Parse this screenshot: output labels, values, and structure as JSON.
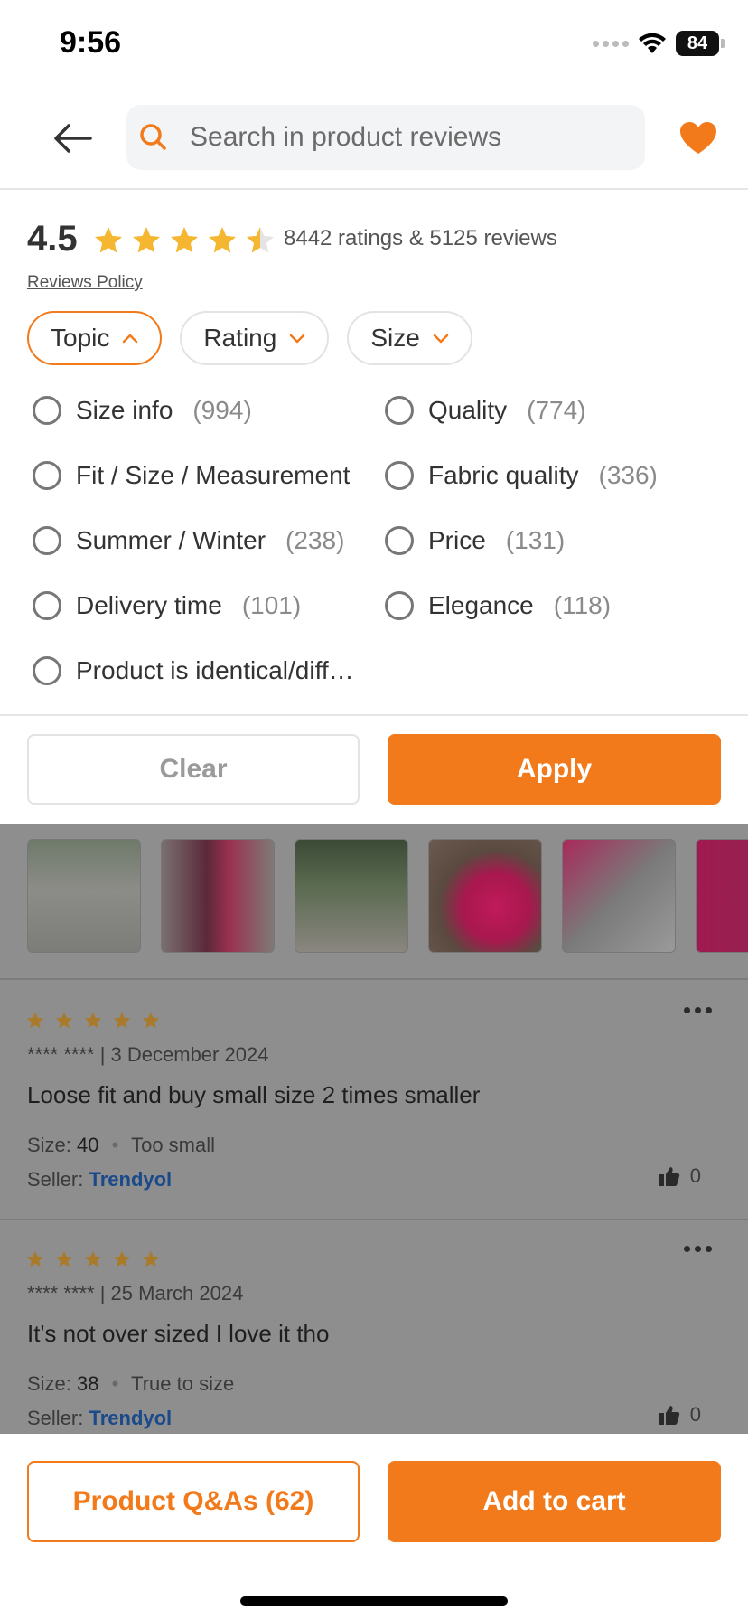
{
  "status_bar": {
    "time": "9:56",
    "battery": "84",
    "icons": [
      "signal-icon",
      "wifi-icon",
      "battery-icon"
    ]
  },
  "header": {
    "search_placeholder": "Search in product reviews",
    "icons": [
      "back-arrow-icon",
      "search-icon",
      "heart-icon"
    ]
  },
  "summary": {
    "rating": "4.5",
    "stars": 4.5,
    "rating_count": "8442 ratings & 5125 reviews",
    "policy_link": "Reviews Policy"
  },
  "filters": {
    "chips": [
      {
        "label": "Topic",
        "active": true
      },
      {
        "label": "Rating",
        "active": false
      },
      {
        "label": "Size",
        "active": false
      }
    ]
  },
  "topics": [
    {
      "label": "Size info",
      "count": "(994)"
    },
    {
      "label": "Quality",
      "count": "(774)"
    },
    {
      "label": "Fit / Size / Measurement",
      "count": ""
    },
    {
      "label": "Fabric quality",
      "count": "(336)"
    },
    {
      "label": "Summer / Winter",
      "count": "(238)"
    },
    {
      "label": "Price",
      "count": "(131)"
    },
    {
      "label": "Delivery time",
      "count": "(101)"
    },
    {
      "label": "Elegance",
      "count": "(118)"
    },
    {
      "label": "Product is identical/different",
      "count": ""
    }
  ],
  "actions": {
    "clear": "Clear",
    "apply": "Apply"
  },
  "reviews": [
    {
      "stars": 5,
      "author_date": "**** **** | 3 December 2024",
      "text": "Loose fit and buy small size 2 times smaller",
      "size_label": "Size:",
      "size_value": "40",
      "fit": "Too small",
      "seller_label": "Seller:",
      "seller": "Trendyol",
      "likes": "0"
    },
    {
      "stars": 5,
      "author_date": "**** **** | 25 March 2024",
      "text": "It's not over sized I love it tho",
      "size_label": "Size:",
      "size_value": "38",
      "fit": "True to size",
      "seller_label": "Seller:",
      "seller": "Trendyol",
      "likes": "0"
    }
  ],
  "bottom_bar": {
    "qa": "Product Q&As (62)",
    "cart": "Add to cart"
  },
  "colors": {
    "accent": "#f27a1a",
    "star": "#f5b731",
    "seller_link": "#1b4a8a"
  }
}
